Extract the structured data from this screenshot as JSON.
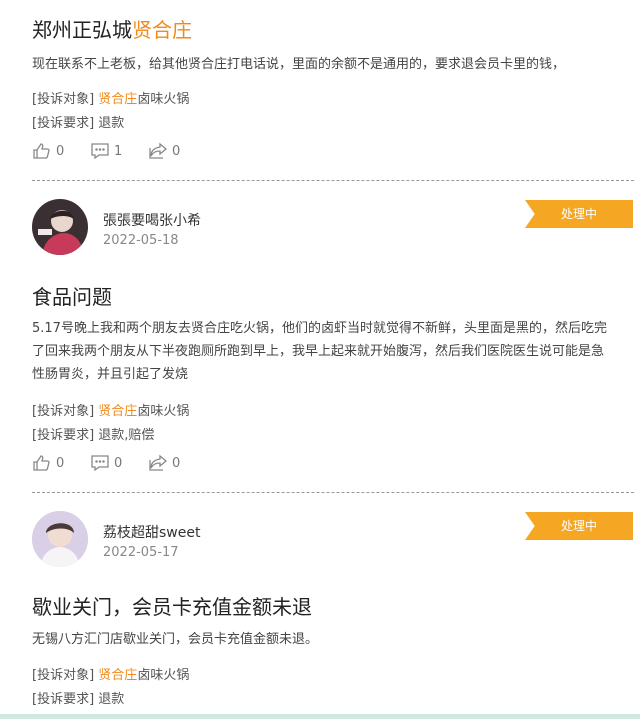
{
  "posts": [
    {
      "title_prefix": "郑州正弘城",
      "title_highlight": "贤合庄",
      "content": "现在联系不上老板，给其他贤合庄打电话说，里面的余额不是通用的，要求退会员卡里的钱，",
      "target_label": "[投诉对象]",
      "target_brand": "贤合庄",
      "target_rest": "卤味火锅",
      "demand_label": "[投诉要求]",
      "demand_value": "退款",
      "likes": "0",
      "comments": "1",
      "shares": "0"
    },
    {
      "username": "張張要喝张小希",
      "date": "2022-05-18",
      "status": "处理中",
      "title": "食品问题",
      "content": "5.17号晚上我和两个朋友去贤合庄吃火锅，他们的卤虾当时就觉得不新鲜，头里面是黑的，然后吃完了回来我两个朋友从下半夜跑厕所跑到早上，我早上起来就开始腹泻，然后我们医院医生说可能是急性肠胃炎，并且引起了发烧",
      "target_label": "[投诉对象]",
      "target_brand": "贤合庄",
      "target_rest": "卤味火锅",
      "demand_label": "[投诉要求]",
      "demand_value": "退款,赔偿",
      "likes": "0",
      "comments": "0",
      "shares": "0"
    },
    {
      "username": "荔枝超甜sweet",
      "date": "2022-05-17",
      "status": "处理中",
      "title": "歇业关门，会员卡充值金额未退",
      "content": "无锡八方汇门店歇业关门，会员卡充值金额未退。",
      "target_label": "[投诉对象]",
      "target_brand": "贤合庄",
      "target_rest": "卤味火锅",
      "demand_label": "[投诉要求]",
      "demand_value": "退款"
    }
  ],
  "icons": {
    "like": "thumbs-up-icon",
    "comment": "comment-icon",
    "share": "share-icon"
  },
  "colors": {
    "accent": "#f08a1c",
    "badge": "#f5a623"
  }
}
